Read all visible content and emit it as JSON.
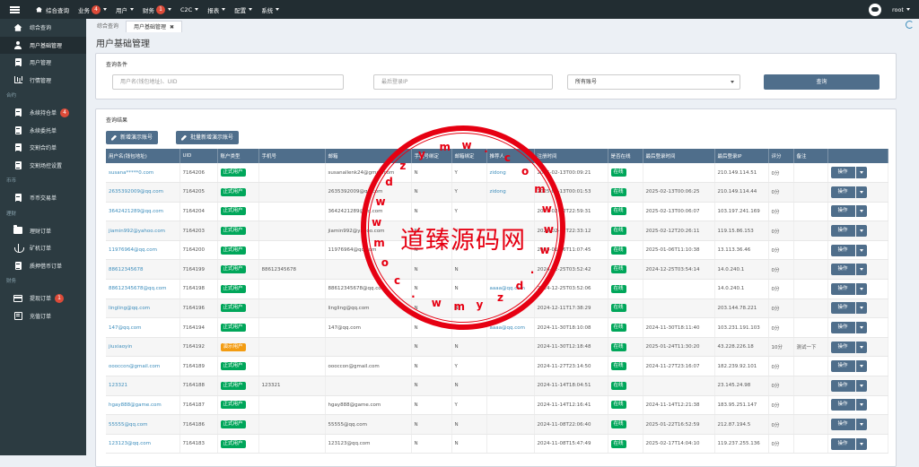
{
  "topnav": [
    {
      "label": "综合查询",
      "badge": "",
      "caret": false
    },
    {
      "label": "业务",
      "badge": "4",
      "caret": true
    },
    {
      "label": "用户",
      "badge": "",
      "caret": true
    },
    {
      "label": "财务",
      "badge": "1",
      "caret": true
    },
    {
      "label": "C2C",
      "badge": "",
      "caret": true
    },
    {
      "label": "报表",
      "badge": "",
      "caret": true
    },
    {
      "label": "配置",
      "badge": "",
      "caret": true
    },
    {
      "label": "系统",
      "badge": "",
      "caret": true
    }
  ],
  "user": "root",
  "sidebar": [
    {
      "type": "item",
      "label": "综合查询",
      "icon": "home-icon",
      "active": false
    },
    {
      "type": "item",
      "label": "用户基础管理",
      "icon": "user-icon",
      "active": true
    },
    {
      "type": "item",
      "label": "用户管理",
      "icon": "doc-icon",
      "active": false
    },
    {
      "type": "item",
      "label": "行情管理",
      "icon": "bar-chart-icon",
      "active": false
    },
    {
      "type": "section",
      "label": "合约"
    },
    {
      "type": "item",
      "label": "永续持仓单",
      "icon": "doc-icon",
      "badge": "4"
    },
    {
      "type": "item",
      "label": "永续委托单",
      "icon": "doc-icon"
    },
    {
      "type": "item",
      "label": "交割合约单",
      "icon": "doc-icon"
    },
    {
      "type": "item",
      "label": "交割场控设置",
      "icon": "doc-icon"
    },
    {
      "type": "section",
      "label": "币币"
    },
    {
      "type": "item",
      "label": "币币交易单",
      "icon": "doc-icon"
    },
    {
      "type": "section",
      "label": "理财"
    },
    {
      "type": "item",
      "label": "理财订单",
      "icon": "folder-icon"
    },
    {
      "type": "item",
      "label": "矿机订单",
      "icon": "anchor-icon"
    },
    {
      "type": "item",
      "label": "质押借币订单",
      "icon": "doc-icon"
    },
    {
      "type": "section",
      "label": "财务"
    },
    {
      "type": "item",
      "label": "提现订单",
      "icon": "card-icon",
      "badge": "1"
    },
    {
      "type": "item",
      "label": "充值订单",
      "icon": "list-icon"
    }
  ],
  "tabs": [
    {
      "label": "综合查询",
      "active": false
    },
    {
      "label": "用户基础管理",
      "active": true,
      "close": "✖"
    }
  ],
  "page_title": "用户基础管理",
  "query": {
    "title": "查询条件",
    "user_ph": "用户名(钱包地址)、UID",
    "ip_ph": "最后登录IP",
    "account_sel": "所有账号",
    "btn": "查询"
  },
  "results": {
    "title": "查询结果",
    "add": "新增演示账号",
    "batch_add": "批量新增演示账号"
  },
  "columns": [
    "用户名(钱包地址)",
    "UID",
    "账户类型",
    "手机号",
    "邮箱",
    "手机号绑定",
    "邮箱绑定",
    "推荐人",
    "注册时间",
    "是否在线",
    "最后登录时间",
    "最后登录IP",
    "评分",
    "备注",
    ""
  ],
  "op_label": "操作",
  "rows": [
    [
      "susana*****0.com",
      "7164206",
      "正式用户",
      "",
      "susanallenk24@gmail.com",
      "N",
      "Y",
      "zidong",
      "2025-02-13T00:09:21",
      "在线",
      "",
      "210.149.114.51",
      "0分",
      ""
    ],
    [
      "2635392009@qq.com",
      "7164205",
      "正式用户",
      "",
      "2635392009@qq.com",
      "N",
      "Y",
      "zidong",
      "2025-02-13T00:01:53",
      "在线",
      "2025-02-13T00:06:25",
      "210.149.114.44",
      "0分",
      ""
    ],
    [
      "3642421289@qq.com",
      "7164204",
      "正式用户",
      "",
      "3642421289@qq.com",
      "N",
      "Y",
      "",
      "2025-02-12T22:59:31",
      "在线",
      "2025-02-13T00:06:07",
      "103.197.241.169",
      "0分",
      ""
    ],
    [
      "jiamin992@yahoo.com",
      "7164203",
      "正式用户",
      "",
      "jiamin992@yahoo.com",
      "N",
      "Y",
      "",
      "2025-02-12T22:33:12",
      "在线",
      "2025-02-12T20:26:11",
      "119.15.86.153",
      "0分",
      ""
    ],
    [
      "11976964@qq.com",
      "7164200",
      "正式用户",
      "",
      "11976964@qq.com",
      "N",
      "Y",
      "",
      "2025-01-06T11:07:45",
      "在线",
      "2025-01-06T11:10:38",
      "13.113.36.46",
      "0分",
      ""
    ],
    [
      "88612345678",
      "7164199",
      "正式用户",
      "88612345678",
      "",
      "N",
      "N",
      "",
      "2024-12-25T03:52:42",
      "在线",
      "2024-12-25T03:54:14",
      "14.0.240.1",
      "0分",
      ""
    ],
    [
      "88612345678@qq.com",
      "7164198",
      "正式用户",
      "",
      "88612345678@qq.com",
      "N",
      "N",
      "aaaa@qq.com",
      "2024-12-25T03:52:06",
      "在线",
      "",
      "14.0.240.1",
      "0分",
      ""
    ],
    [
      "lingling@qq.com",
      "7164196",
      "正式用户",
      "",
      "lingling@qq.com",
      "N",
      "N",
      "",
      "2024-12-11T17:38:29",
      "在线",
      "",
      "203.144.78.221",
      "0分",
      ""
    ],
    [
      "147@qq.com",
      "7164194",
      "正式用户",
      "",
      "147@qq.com",
      "N",
      "N",
      "aaaa@qq.com",
      "2024-11-30T18:10:08",
      "在线",
      "2024-11-30T18:11:40",
      "103.231.191.103",
      "0分",
      ""
    ],
    [
      "jiuxiaoyin",
      "7164192",
      "演示用户",
      "",
      "",
      "N",
      "N",
      "",
      "2024-11-30T12:18:48",
      "在线",
      "2025-01-24T11:30:20",
      "43.228.226.18",
      "10分",
      "测试一下"
    ],
    [
      "oooccon@gmail.com",
      "7164189",
      "正式用户",
      "",
      "oooccon@gmail.com",
      "N",
      "Y",
      "",
      "2024-11-27T23:14:50",
      "在线",
      "2024-11-27T23:16:07",
      "182.239.92.101",
      "0分",
      ""
    ],
    [
      "123321",
      "7164188",
      "正式用户",
      "123321",
      "",
      "N",
      "N",
      "",
      "2024-11-14T18:04:51",
      "在线",
      "",
      "23.145.24.98",
      "0分",
      ""
    ],
    [
      "hgay888@game.com",
      "7164187",
      "正式用户",
      "",
      "hgay888@game.com",
      "N",
      "Y",
      "",
      "2024-11-14T12:16:41",
      "在线",
      "2024-11-14T12:21:38",
      "183.95.251.147",
      "0分",
      ""
    ],
    [
      "55555@qq.com",
      "7164186",
      "正式用户",
      "",
      "55555@qq.com",
      "N",
      "N",
      "",
      "2024-11-08T22:06:40",
      "在线",
      "2025-01-22T16:52:59",
      "212.87.194.5",
      "0分",
      ""
    ],
    [
      "123123@qq.com",
      "7164183",
      "正式用户",
      "",
      "123123@qq.com",
      "N",
      "N",
      "",
      "2024-11-08T15:47:49",
      "在线",
      "2025-02-17T14:04:10",
      "119.237.255.136",
      "0分",
      ""
    ]
  ],
  "watermark": {
    "text": "道臻源码网",
    "letters": [
      "d",
      "z",
      "y",
      "m",
      "w",
      ".",
      "c",
      "o",
      "m",
      "w",
      "w",
      "w",
      ".",
      "d",
      "z",
      "y",
      "m",
      "w",
      ".",
      "c",
      "o",
      "m",
      "w",
      "w"
    ]
  },
  "colors": {
    "sidebar": "#2c3b41",
    "topbar": "#222d32",
    "button": "#4f6e8b",
    "green": "#00a65a",
    "orange": "#f39c12",
    "red": "#dd4b39",
    "watermark": "#e60012"
  }
}
